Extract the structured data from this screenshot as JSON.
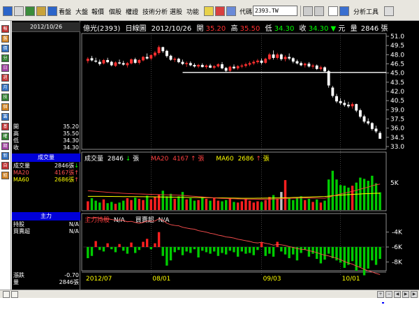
{
  "toolbar": {
    "menus": [
      "看盤",
      "大盤",
      "報價",
      "個股",
      "權證",
      "技術分析",
      "選股",
      "功能"
    ],
    "code_label": "代碼",
    "code_value": "2393.TW",
    "analysis_tools": "分析工具"
  },
  "left_strip_icons": [
    "報",
    "盤",
    "價",
    "分",
    "日",
    "週",
    "月",
    "技",
    "個",
    "籌",
    "基",
    "權",
    "期",
    "新",
    "自",
    "組"
  ],
  "panel": {
    "date": "2012/10/26",
    "ohlc": [
      {
        "label": "開",
        "value": "35.20"
      },
      {
        "label": "高",
        "value": "35.50"
      },
      {
        "label": "低",
        "value": "34.30"
      },
      {
        "label": "收",
        "value": "34.30"
      }
    ],
    "volume_header": "成交量",
    "volume_rows": [
      {
        "label": "成交量",
        "value": "2846張",
        "arrow": "down"
      },
      {
        "label": "MA20",
        "value": "4167張",
        "arrow": "up"
      },
      {
        "label": "MA60",
        "value": "2686張",
        "arrow": "up"
      }
    ],
    "main_header": "主力",
    "main_rows": [
      {
        "label": "持股",
        "value": "N/A"
      },
      {
        "label": "買賣超",
        "value": "N/A"
      }
    ],
    "bottom_rows": [
      {
        "label": "漲跌",
        "value": "-0.70"
      },
      {
        "label": "量",
        "value": "2846張"
      }
    ]
  },
  "chart": {
    "header": {
      "name": "億光(2393)",
      "period": "日線圖",
      "date": "2012/10/26",
      "open_label": "開",
      "open": "35.20",
      "high_label": "高",
      "high": "35.50",
      "low_label": "低",
      "low": "34.30",
      "close_label": "收",
      "close": "34.30",
      "change_arrow": "▼",
      "unit": "元",
      "vol_label": "量",
      "volume": "2846",
      "vol_unit": "張"
    },
    "price_ticks": [
      "51.0",
      "49.5",
      "48.0",
      "46.5",
      "45.0",
      "43.5",
      "42.0",
      "40.5",
      "39.0",
      "37.5",
      "36.0",
      "34.5",
      "33.0"
    ],
    "volume_header": {
      "label": "成交量",
      "value": "2846",
      "ma20_label": "MA20",
      "ma20": "4167",
      "ma60_label": "MA60",
      "ma60": "2686",
      "unit": "張"
    },
    "volume_tick": "5K",
    "main_header": {
      "label1": "主力持股",
      "value1": "N/A",
      "label2": "買賣超",
      "value2": "N/A"
    },
    "main_ticks": [
      "-4K",
      "-6K",
      "-8K"
    ],
    "date_labels": [
      "2012/07",
      "08/01",
      "09/03",
      "10/01"
    ]
  },
  "chart_data": {
    "type": "candlestick",
    "title": "億光(2393) 日線圖",
    "price_ylim": [
      33.0,
      51.0
    ],
    "resistance_line": 45.1,
    "x_labels": [
      "2012/07",
      "08/01",
      "09/03",
      "10/01"
    ],
    "candles": [
      {
        "o": 47.0,
        "h": 47.6,
        "l": 46.6,
        "c": 47.3
      },
      {
        "o": 47.4,
        "h": 47.8,
        "l": 46.9,
        "c": 47.1
      },
      {
        "o": 47.0,
        "h": 47.5,
        "l": 46.7,
        "c": 46.9
      },
      {
        "o": 46.8,
        "h": 47.2,
        "l": 46.2,
        "c": 46.5
      },
      {
        "o": 46.6,
        "h": 47.3,
        "l": 46.4,
        "c": 47.1
      },
      {
        "o": 47.1,
        "h": 47.5,
        "l": 46.6,
        "c": 46.8
      },
      {
        "o": 46.8,
        "h": 47.0,
        "l": 46.1,
        "c": 46.3
      },
      {
        "o": 46.2,
        "h": 46.9,
        "l": 46.0,
        "c": 46.7
      },
      {
        "o": 46.7,
        "h": 47.2,
        "l": 46.4,
        "c": 46.6
      },
      {
        "o": 46.6,
        "h": 47.0,
        "l": 46.2,
        "c": 46.4
      },
      {
        "o": 46.3,
        "h": 46.8,
        "l": 45.9,
        "c": 46.6
      },
      {
        "o": 46.6,
        "h": 47.4,
        "l": 46.4,
        "c": 47.2
      },
      {
        "o": 47.2,
        "h": 47.5,
        "l": 46.5,
        "c": 46.7
      },
      {
        "o": 46.7,
        "h": 47.3,
        "l": 46.4,
        "c": 47.1
      },
      {
        "o": 47.1,
        "h": 47.8,
        "l": 46.9,
        "c": 47.6
      },
      {
        "o": 47.6,
        "h": 48.2,
        "l": 47.2,
        "c": 47.4
      },
      {
        "o": 47.4,
        "h": 48.1,
        "l": 47.1,
        "c": 47.9
      },
      {
        "o": 47.9,
        "h": 48.6,
        "l": 47.6,
        "c": 48.3
      },
      {
        "o": 48.3,
        "h": 49.5,
        "l": 48.0,
        "c": 49.2
      },
      {
        "o": 49.2,
        "h": 49.3,
        "l": 48.3,
        "c": 48.6
      },
      {
        "o": 48.6,
        "h": 48.8,
        "l": 47.5,
        "c": 47.8
      },
      {
        "o": 47.8,
        "h": 48.0,
        "l": 47.0,
        "c": 47.2
      },
      {
        "o": 47.2,
        "h": 47.6,
        "l": 46.8,
        "c": 47.3
      },
      {
        "o": 47.3,
        "h": 47.5,
        "l": 46.6,
        "c": 46.8
      },
      {
        "o": 46.8,
        "h": 47.2,
        "l": 46.3,
        "c": 46.5
      },
      {
        "o": 46.5,
        "h": 46.9,
        "l": 46.0,
        "c": 46.6
      },
      {
        "o": 46.6,
        "h": 46.9,
        "l": 46.1,
        "c": 46.3
      },
      {
        "o": 46.3,
        "h": 46.6,
        "l": 45.9,
        "c": 46.1
      },
      {
        "o": 46.1,
        "h": 46.5,
        "l": 45.8,
        "c": 46.3
      },
      {
        "o": 46.3,
        "h": 46.6,
        "l": 45.9,
        "c": 46.0
      },
      {
        "o": 46.0,
        "h": 46.4,
        "l": 45.7,
        "c": 46.2
      },
      {
        "o": 46.2,
        "h": 46.5,
        "l": 45.8,
        "c": 45.9
      },
      {
        "o": 45.9,
        "h": 46.3,
        "l": 45.6,
        "c": 46.1
      },
      {
        "o": 46.1,
        "h": 46.6,
        "l": 45.9,
        "c": 46.4
      },
      {
        "o": 46.4,
        "h": 46.8,
        "l": 45.6,
        "c": 45.8
      },
      {
        "o": 45.8,
        "h": 46.0,
        "l": 45.2,
        "c": 45.4
      },
      {
        "o": 45.4,
        "h": 46.2,
        "l": 45.2,
        "c": 46.0
      },
      {
        "o": 46.0,
        "h": 46.4,
        "l": 45.6,
        "c": 45.8
      },
      {
        "o": 45.8,
        "h": 46.3,
        "l": 45.5,
        "c": 46.1
      },
      {
        "o": 46.1,
        "h": 46.5,
        "l": 45.8,
        "c": 46.2
      },
      {
        "o": 46.2,
        "h": 46.7,
        "l": 45.9,
        "c": 46.4
      },
      {
        "o": 46.4,
        "h": 46.9,
        "l": 46.1,
        "c": 46.6
      },
      {
        "o": 46.6,
        "h": 47.1,
        "l": 46.3,
        "c": 46.8
      },
      {
        "o": 46.8,
        "h": 47.3,
        "l": 46.5,
        "c": 47.0
      },
      {
        "o": 47.0,
        "h": 47.4,
        "l": 46.4,
        "c": 46.7
      },
      {
        "o": 46.7,
        "h": 47.5,
        "l": 46.5,
        "c": 47.3
      },
      {
        "o": 47.3,
        "h": 48.3,
        "l": 47.1,
        "c": 48.0
      },
      {
        "o": 48.0,
        "h": 48.7,
        "l": 47.2,
        "c": 47.5
      },
      {
        "o": 47.5,
        "h": 48.3,
        "l": 47.2,
        "c": 48.0
      },
      {
        "o": 48.0,
        "h": 48.2,
        "l": 47.0,
        "c": 47.3
      },
      {
        "o": 47.3,
        "h": 47.9,
        "l": 46.9,
        "c": 47.6
      },
      {
        "o": 47.6,
        "h": 48.2,
        "l": 47.1,
        "c": 47.4
      },
      {
        "o": 47.4,
        "h": 47.6,
        "l": 46.6,
        "c": 46.9
      },
      {
        "o": 46.9,
        "h": 47.2,
        "l": 46.4,
        "c": 46.6
      },
      {
        "o": 46.6,
        "h": 46.9,
        "l": 46.1,
        "c": 46.3
      },
      {
        "o": 46.3,
        "h": 46.7,
        "l": 45.9,
        "c": 46.5
      },
      {
        "o": 46.5,
        "h": 46.8,
        "l": 45.9,
        "c": 46.1
      },
      {
        "o": 46.1,
        "h": 46.5,
        "l": 45.7,
        "c": 46.2
      },
      {
        "o": 46.2,
        "h": 46.4,
        "l": 45.5,
        "c": 45.7
      },
      {
        "o": 45.7,
        "h": 46.2,
        "l": 45.4,
        "c": 45.9
      },
      {
        "o": 45.9,
        "h": 46.1,
        "l": 45.1,
        "c": 45.3
      },
      {
        "o": 45.3,
        "h": 45.5,
        "l": 42.6,
        "c": 43.0
      },
      {
        "o": 42.6,
        "h": 42.9,
        "l": 41.0,
        "c": 41.3
      },
      {
        "o": 41.2,
        "h": 41.6,
        "l": 40.1,
        "c": 40.4
      },
      {
        "o": 40.4,
        "h": 40.9,
        "l": 39.8,
        "c": 40.1
      },
      {
        "o": 40.1,
        "h": 40.6,
        "l": 39.5,
        "c": 39.8
      },
      {
        "o": 39.8,
        "h": 40.3,
        "l": 39.3,
        "c": 39.6
      },
      {
        "o": 39.6,
        "h": 40.2,
        "l": 39.2,
        "c": 39.9
      },
      {
        "o": 39.9,
        "h": 40.0,
        "l": 38.6,
        "c": 38.9
      },
      {
        "o": 38.9,
        "h": 39.2,
        "l": 37.6,
        "c": 37.9
      },
      {
        "o": 37.9,
        "h": 38.2,
        "l": 36.8,
        "c": 37.1
      },
      {
        "o": 37.1,
        "h": 37.6,
        "l": 36.5,
        "c": 36.8
      },
      {
        "o": 36.8,
        "h": 37.0,
        "l": 35.6,
        "c": 35.9
      },
      {
        "o": 35.9,
        "h": 36.4,
        "l": 35.2,
        "c": 35.5
      },
      {
        "o": 35.2,
        "h": 35.5,
        "l": 34.3,
        "c": 34.3
      }
    ],
    "volume_ylim": [
      0,
      7500
    ],
    "volumes": [
      1400,
      1900,
      1500,
      1200,
      1700,
      1100,
      1300,
      1000,
      1200,
      1500,
      1900,
      1600,
      2000,
      1800,
      1600,
      2300,
      1700,
      2100,
      2500,
      3100,
      2200,
      2600,
      1800,
      2200,
      2900,
      1700,
      1900,
      1500,
      1600,
      2100,
      1800,
      1500,
      2000,
      1500,
      1400,
      1600,
      1900,
      1300,
      1200,
      1400,
      1800,
      1500,
      1200,
      1400,
      1300,
      1600,
      2100,
      2400,
      1800,
      2900,
      4800,
      1900,
      1600,
      2000,
      2200,
      1600,
      1800,
      1300,
      1700,
      1200,
      1500,
      4900,
      6300,
      4900,
      4000,
      3900,
      3600,
      3900,
      4400,
      5200,
      5000,
      4700,
      5500,
      4300,
      2846
    ],
    "volume_ma20": [
      3100,
      3050,
      3000,
      2950,
      2900,
      2850,
      2800,
      2760,
      2720,
      2680,
      2650,
      2620,
      2600,
      2580,
      2560,
      2540,
      2520,
      2500,
      2480,
      2460,
      2440,
      2420,
      2400,
      2380,
      2350,
      2300,
      2250,
      2200,
      2150,
      2100,
      2050,
      2000,
      1950,
      1900,
      1870,
      1850,
      1830,
      1810,
      1790,
      1770,
      1750,
      1740,
      1730,
      1720,
      1720,
      1730,
      1740,
      1760,
      1780,
      1800,
      1850,
      1880,
      1900,
      1910,
      1920,
      1930,
      1930,
      1930,
      1920,
      1910,
      1900,
      2050,
      2250,
      2420,
      2580,
      2720,
      2850,
      3000,
      3150,
      3350,
      3520,
      3680,
      3900,
      4050,
      4167
    ],
    "volume_ma60": [
      2200,
      2200,
      2200,
      2190,
      2190,
      2180,
      2180,
      2170,
      2170,
      2160,
      2160,
      2150,
      2150,
      2140,
      2140,
      2130,
      2120,
      2110,
      2100,
      2090,
      2080,
      2070,
      2060,
      2050,
      2040,
      2030,
      2020,
      2010,
      2000,
      1990,
      1980,
      1970,
      1960,
      1950,
      1940,
      1930,
      1920,
      1910,
      1900,
      1890,
      1890,
      1890,
      1890,
      1900,
      1900,
      1910,
      1920,
      1930,
      1940,
      1950,
      1970,
      1990,
      2010,
      2030,
      2050,
      2070,
      2090,
      2110,
      2130,
      2150,
      2170,
      2230,
      2290,
      2340,
      2390,
      2430,
      2470,
      2510,
      2550,
      2580,
      2610,
      2630,
      2660,
      2680,
      2686
    ],
    "main_ylim": [
      -9000,
      -3000
    ],
    "main_net": [
      -1500,
      -1200,
      800,
      -400,
      -600,
      500,
      -300,
      -700,
      400,
      -500,
      -900,
      600,
      -800,
      -400,
      700,
      1100,
      -300,
      500,
      2000,
      -1200,
      -2500,
      -1800,
      -700,
      -400,
      -1100,
      -600,
      -800,
      -300,
      -1400,
      -500,
      -700,
      -900,
      -600,
      -1200,
      -800,
      -1000,
      -500,
      -700,
      -1300,
      -600,
      -900,
      -800,
      -1100,
      -400,
      600,
      -1200,
      -900,
      -1300,
      700,
      -600,
      -1000,
      -1500,
      -1000,
      -1800,
      -800,
      -400,
      -1300,
      -900,
      -1600,
      -2200,
      -1700,
      -900,
      -1500,
      -1800,
      -2100,
      -2800,
      -2400,
      -1900,
      -3200,
      -2700,
      -3800,
      -2900,
      -1800,
      -2400,
      -1600
    ],
    "main_holding": [
      -2000,
      -2100,
      -2000,
      -2150,
      -2250,
      -2200,
      -2300,
      -2400,
      -2350,
      -2450,
      -2600,
      -2550,
      -2700,
      -2800,
      -2700,
      -2500,
      -2550,
      -2500,
      -2200,
      -2400,
      -2800,
      -3000,
      -3100,
      -3150,
      -3350,
      -3450,
      -3550,
      -3600,
      -3800,
      -3900,
      -4000,
      -4150,
      -4250,
      -4400,
      -4500,
      -4650,
      -4700,
      -4800,
      -4950,
      -5050,
      -5150,
      -5250,
      -5400,
      -5450,
      -5350,
      -5500,
      -5600,
      -5750,
      -5650,
      -5700,
      -5800,
      -5950,
      -6050,
      -6200,
      -6300,
      -6350,
      -6500,
      -6600,
      -6750,
      -6950,
      -7100,
      -7200,
      -7350,
      -7500,
      -7700,
      -7950,
      -8150,
      -8300,
      -8550,
      -8750,
      -9000,
      -9200,
      -9350,
      -9550,
      -9700
    ]
  }
}
